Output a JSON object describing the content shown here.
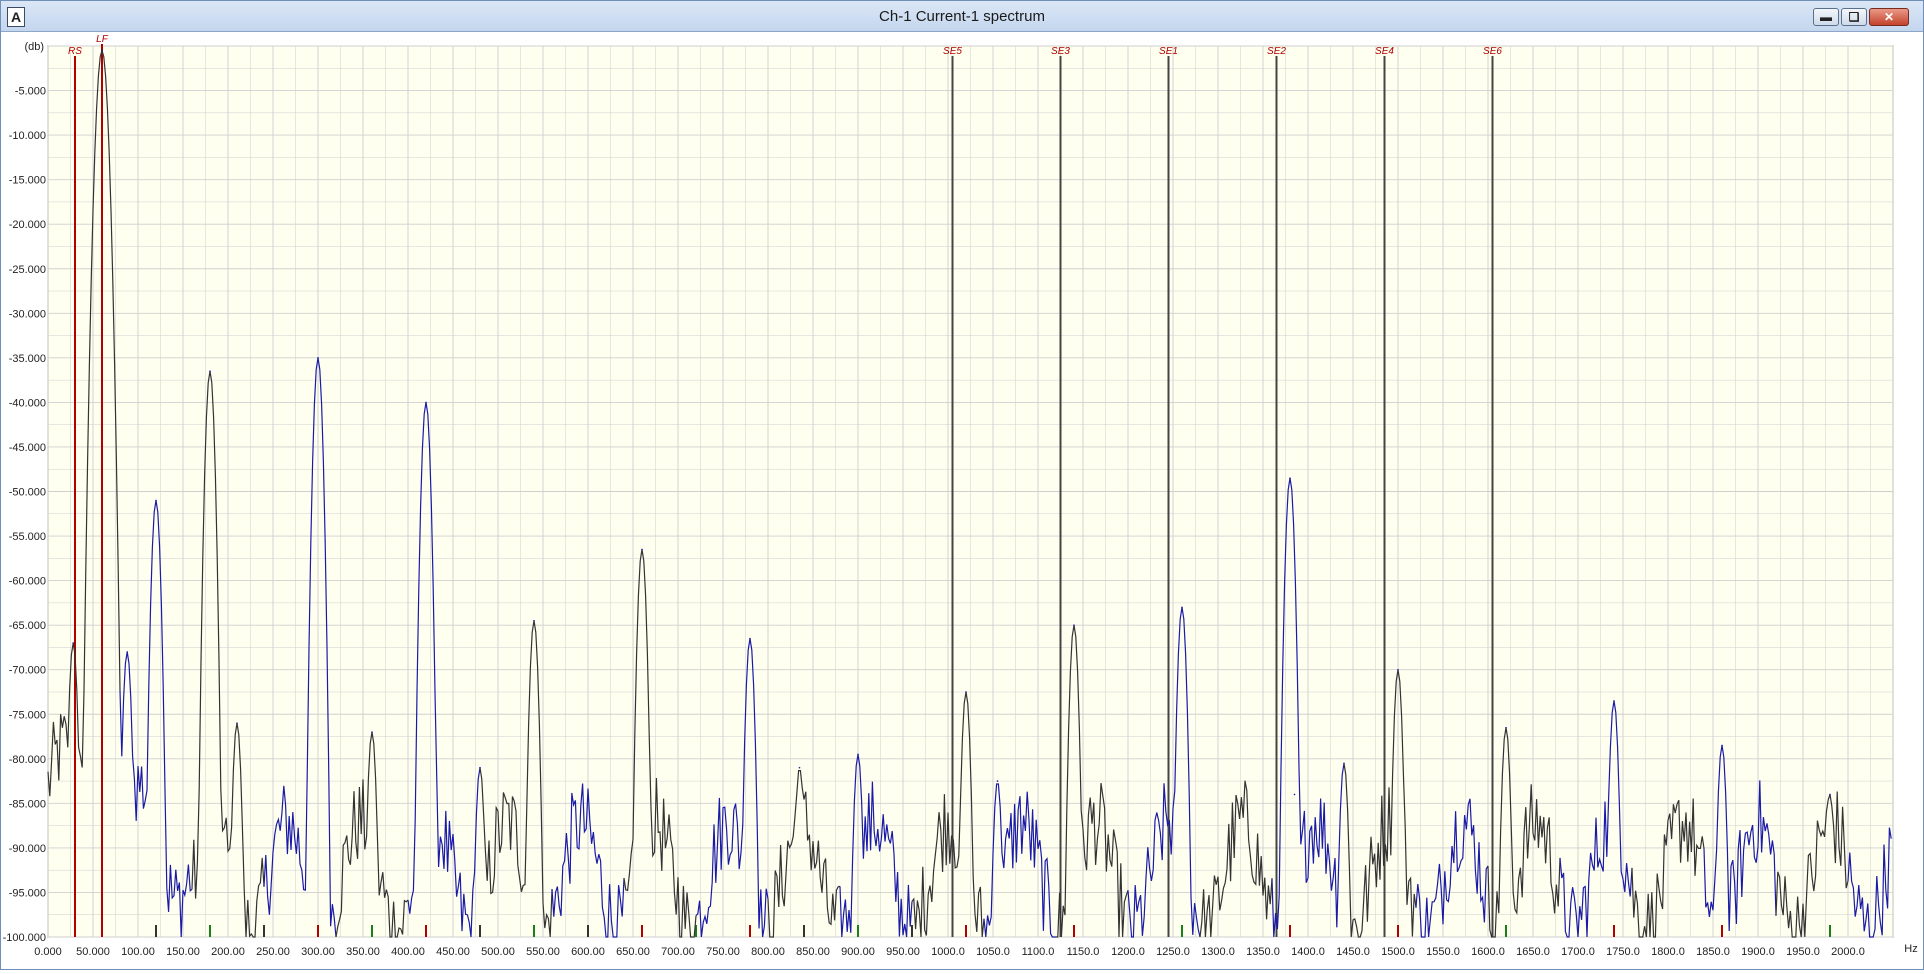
{
  "window": {
    "title": "Ch-1 Current-1 spectrum",
    "icon_letter": "A",
    "minimize_icon": "minimize-icon",
    "restore_icon": "restore-icon",
    "close_icon": "close-icon"
  },
  "colors": {
    "plot_background": "#fffff0",
    "grid": "#cfcfcf",
    "trace_blue": "#1a1aa8",
    "trace_dark": "#333333",
    "marker_red": "#b00000",
    "marker_dark": "#444444",
    "tick_green": "#1a7f1a"
  },
  "chart_data": {
    "type": "line",
    "title": "",
    "xlabel": "",
    "ylabel": "",
    "y_unit_label": "(db)",
    "x_unit_label": "Hz",
    "xlim": [
      0,
      2050
    ],
    "ylim": [
      -100,
      0
    ],
    "grid": true,
    "y_ticks": [
      "-5.000",
      "-10.000",
      "-15.000",
      "-20.000",
      "-25.000",
      "-30.000",
      "-35.000",
      "-40.000",
      "-45.000",
      "-50.000",
      "-55.000",
      "-60.000",
      "-65.000",
      "-70.000",
      "-75.000",
      "-80.000",
      "-85.000",
      "-90.000",
      "-95.000",
      "-100.000"
    ],
    "y_tick_values": [
      -5,
      -10,
      -15,
      -20,
      -25,
      -30,
      -35,
      -40,
      -45,
      -50,
      -55,
      -60,
      -65,
      -70,
      -75,
      -80,
      -85,
      -90,
      -95,
      -100
    ],
    "x_ticks": [
      "0.000",
      "50.000",
      "100.00",
      "150.00",
      "200.00",
      "250.00",
      "300.00",
      "350.00",
      "400.00",
      "450.00",
      "500.00",
      "550.00",
      "600.00",
      "650.00",
      "700.00",
      "750.00",
      "800.00",
      "850.00",
      "900.00",
      "950.00",
      "1000.0",
      "1050.0",
      "1100.0",
      "1150.0",
      "1200.0",
      "1250.0",
      "1300.0",
      "1350.0",
      "1400.0",
      "1450.0",
      "1500.0",
      "1550.0",
      "1600.0",
      "1650.0",
      "1700.0",
      "1750.0",
      "1800.0",
      "1850.0",
      "1900.0",
      "1950.0",
      "2000.0"
    ],
    "x_tick_values": [
      0,
      50,
      100,
      150,
      200,
      250,
      300,
      350,
      400,
      450,
      500,
      550,
      600,
      650,
      700,
      750,
      800,
      850,
      900,
      950,
      1000,
      1050,
      1100,
      1150,
      1200,
      1250,
      1300,
      1350,
      1400,
      1450,
      1500,
      1550,
      1600,
      1650,
      1700,
      1750,
      1800,
      1850,
      1900,
      1950,
      2000
    ],
    "markers": [
      {
        "label": "RS",
        "x": 30,
        "color": "red"
      },
      {
        "label": "LF",
        "x": 60,
        "color": "red"
      },
      {
        "label": "SE5",
        "x": 1005,
        "color": "dark"
      },
      {
        "label": "SE3",
        "x": 1125,
        "color": "dark"
      },
      {
        "label": "SE1",
        "x": 1245,
        "color": "dark"
      },
      {
        "label": "SE2",
        "x": 1365,
        "color": "dark"
      },
      {
        "label": "SE4",
        "x": 1485,
        "color": "dark"
      },
      {
        "label": "SE6",
        "x": 1605,
        "color": "dark"
      }
    ],
    "peaks": [
      {
        "x": 28,
        "y": -67
      },
      {
        "x": 60,
        "y": -0.5
      },
      {
        "x": 88,
        "y": -68
      },
      {
        "x": 120,
        "y": -51
      },
      {
        "x": 180,
        "y": -36.5
      },
      {
        "x": 210,
        "y": -76
      },
      {
        "x": 300,
        "y": -35
      },
      {
        "x": 360,
        "y": -77
      },
      {
        "x": 420,
        "y": -40
      },
      {
        "x": 480,
        "y": -81
      },
      {
        "x": 540,
        "y": -64.5
      },
      {
        "x": 660,
        "y": -56.5
      },
      {
        "x": 780,
        "y": -66.5
      },
      {
        "x": 835,
        "y": -81
      },
      {
        "x": 900,
        "y": -79.5
      },
      {
        "x": 1020,
        "y": -72.5
      },
      {
        "x": 1055,
        "y": -82.5
      },
      {
        "x": 1140,
        "y": -65
      },
      {
        "x": 1260,
        "y": -63
      },
      {
        "x": 1380,
        "y": -48.5
      },
      {
        "x": 1385,
        "y": -84
      },
      {
        "x": 1440,
        "y": -80.5
      },
      {
        "x": 1500,
        "y": -70
      },
      {
        "x": 1620,
        "y": -76.5
      },
      {
        "x": 1740,
        "y": -73.5
      },
      {
        "x": 1860,
        "y": -78.5
      },
      {
        "x": 1980,
        "y": -84
      }
    ],
    "noise_floor": [
      -100,
      -86
    ]
  }
}
